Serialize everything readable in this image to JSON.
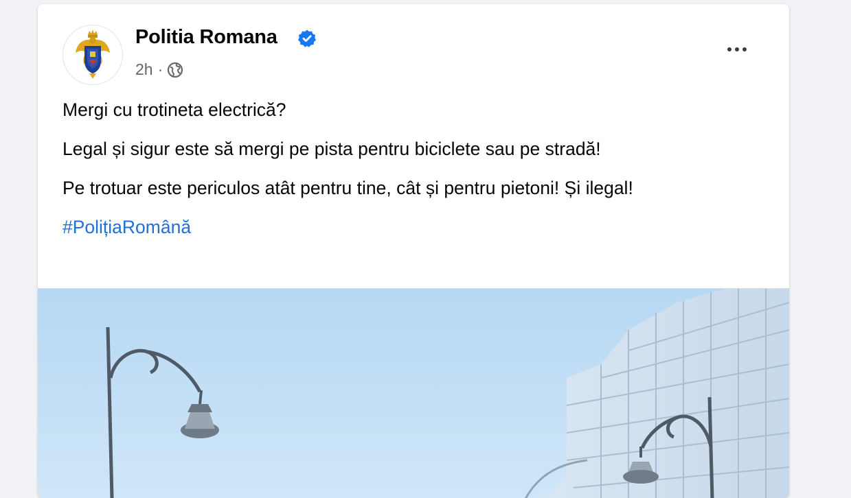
{
  "post": {
    "author": "Politia Romana",
    "verified_icon": "verified-badge-icon",
    "time": "2h",
    "separator": "·",
    "audience_icon": "globe-icon",
    "more_icon": "more-options-icon",
    "paragraphs": [
      "Mergi cu trotineta electrică?",
      "Legal și sigur este să mergi pe pista pentru biciclete sau pe stradă!",
      "Pe trotuar este periculos atât pentru tine, cât și pentru pietoni! Și ilegal!"
    ],
    "hashtag": "#PolițiaRomână"
  },
  "colors": {
    "link": "#216fdb",
    "verified": "#1877f2",
    "secondary_text": "#65676b"
  }
}
